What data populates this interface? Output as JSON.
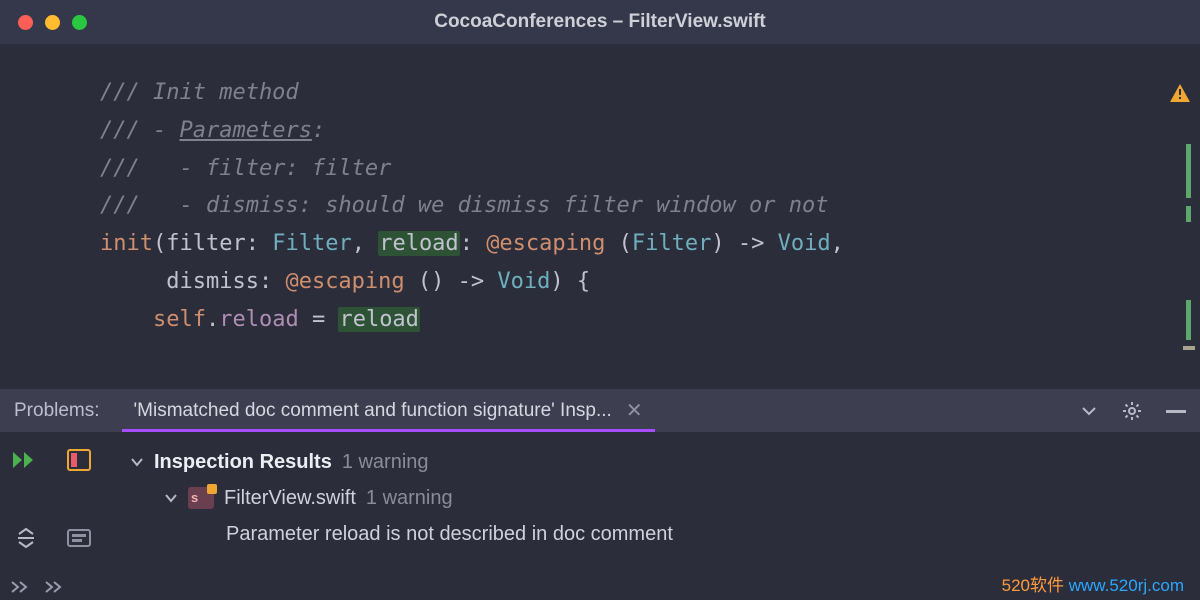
{
  "window": {
    "title": "CocoaConferences – FilterView.swift"
  },
  "code": {
    "l1": "/// Init method",
    "l2a": "/// - ",
    "l2b": "Parameters",
    "l2c": ":",
    "l3": "///   - filter: filter",
    "l4": "///   - dismiss: should we dismiss filter window or not",
    "init_kw": "init",
    "filter_name": "filter",
    "filter_type": "Filter",
    "reload_name": "reload",
    "escaping_kw": "@escaping",
    "void_type": "Void",
    "dismiss_name": "dismiss",
    "self_kw": "self",
    "prop_reload": "reload",
    "eq": " = ",
    "assign_reload": "reload"
  },
  "problems": {
    "label": "Problems:",
    "tab_title": "'Mismatched doc comment and function signature' Insp...",
    "tree": {
      "root_title": "Inspection Results",
      "root_count": "1 warning",
      "file_name": "FilterView.swift",
      "file_count": "1 warning",
      "issue_text": "Parameter reload is not described in doc comment"
    }
  },
  "watermark": {
    "a": "520软件 ",
    "b": "www.520rj.com"
  }
}
